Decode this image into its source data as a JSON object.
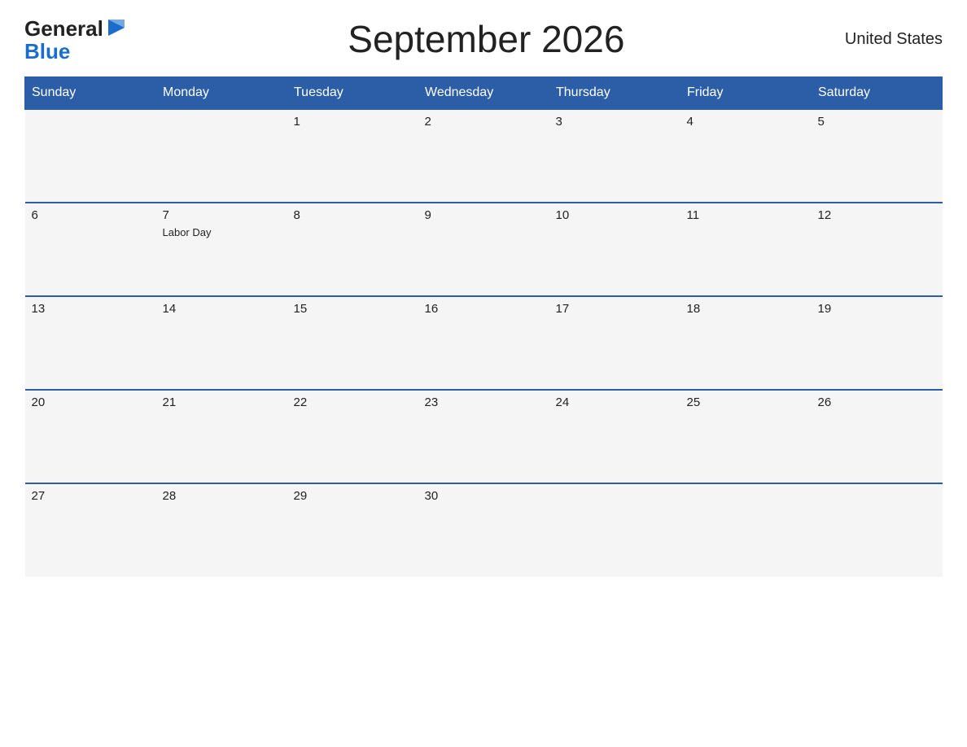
{
  "header": {
    "logo_general": "General",
    "logo_blue": "Blue",
    "title": "September 2026",
    "country": "United States"
  },
  "calendar": {
    "days_of_week": [
      "Sunday",
      "Monday",
      "Tuesday",
      "Wednesday",
      "Thursday",
      "Friday",
      "Saturday"
    ],
    "weeks": [
      [
        {
          "day": "",
          "holiday": ""
        },
        {
          "day": "",
          "holiday": ""
        },
        {
          "day": "1",
          "holiday": ""
        },
        {
          "day": "2",
          "holiday": ""
        },
        {
          "day": "3",
          "holiday": ""
        },
        {
          "day": "4",
          "holiday": ""
        },
        {
          "day": "5",
          "holiday": ""
        }
      ],
      [
        {
          "day": "6",
          "holiday": ""
        },
        {
          "day": "7",
          "holiday": "Labor Day"
        },
        {
          "day": "8",
          "holiday": ""
        },
        {
          "day": "9",
          "holiday": ""
        },
        {
          "day": "10",
          "holiday": ""
        },
        {
          "day": "11",
          "holiday": ""
        },
        {
          "day": "12",
          "holiday": ""
        }
      ],
      [
        {
          "day": "13",
          "holiday": ""
        },
        {
          "day": "14",
          "holiday": ""
        },
        {
          "day": "15",
          "holiday": ""
        },
        {
          "day": "16",
          "holiday": ""
        },
        {
          "day": "17",
          "holiday": ""
        },
        {
          "day": "18",
          "holiday": ""
        },
        {
          "day": "19",
          "holiday": ""
        }
      ],
      [
        {
          "day": "20",
          "holiday": ""
        },
        {
          "day": "21",
          "holiday": ""
        },
        {
          "day": "22",
          "holiday": ""
        },
        {
          "day": "23",
          "holiday": ""
        },
        {
          "day": "24",
          "holiday": ""
        },
        {
          "day": "25",
          "holiday": ""
        },
        {
          "day": "26",
          "holiday": ""
        }
      ],
      [
        {
          "day": "27",
          "holiday": ""
        },
        {
          "day": "28",
          "holiday": ""
        },
        {
          "day": "29",
          "holiday": ""
        },
        {
          "day": "30",
          "holiday": ""
        },
        {
          "day": "",
          "holiday": ""
        },
        {
          "day": "",
          "holiday": ""
        },
        {
          "day": "",
          "holiday": ""
        }
      ]
    ]
  }
}
